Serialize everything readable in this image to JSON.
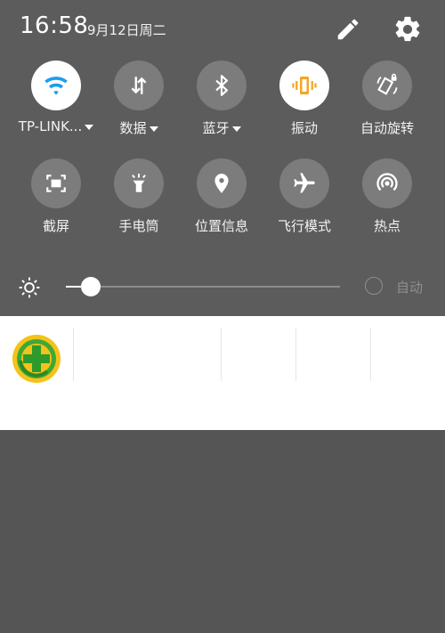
{
  "status_bar": {
    "time": "16:58",
    "date": "9月12日周二"
  },
  "quick_tiles": [
    {
      "label": "TP-LINK...",
      "icon": "wifi-icon",
      "active": true,
      "dropdown": true
    },
    {
      "label": "数据",
      "icon": "data-transfer-icon",
      "active": false,
      "dropdown": true
    },
    {
      "label": "蓝牙",
      "icon": "bluetooth-icon",
      "active": false,
      "dropdown": true
    },
    {
      "label": "振动",
      "icon": "vibrate-icon",
      "active": true,
      "dropdown": false
    },
    {
      "label": "自动旋转",
      "icon": "rotate-lock-icon",
      "active": false,
      "dropdown": false
    },
    {
      "label": "截屏",
      "icon": "screenshot-icon",
      "active": false,
      "dropdown": false
    },
    {
      "label": "手电筒",
      "icon": "flashlight-icon",
      "active": false,
      "dropdown": false
    },
    {
      "label": "位置信息",
      "icon": "location-icon",
      "active": false,
      "dropdown": false
    },
    {
      "label": "飞行模式",
      "icon": "airplane-icon",
      "active": false,
      "dropdown": false
    },
    {
      "label": "热点",
      "icon": "hotspot-icon",
      "active": false,
      "dropdown": false
    }
  ],
  "brightness": {
    "level_fraction": 0.09,
    "auto_label": "自动",
    "auto_enabled": false
  },
  "notification": {
    "app_icon": "360-security-icon"
  },
  "colors": {
    "wifi_active": "#1a9df0",
    "vibrate_active": "#f5a623",
    "shade_bg": "#5c5c5c",
    "tile_bg": "#7c7c7c"
  }
}
